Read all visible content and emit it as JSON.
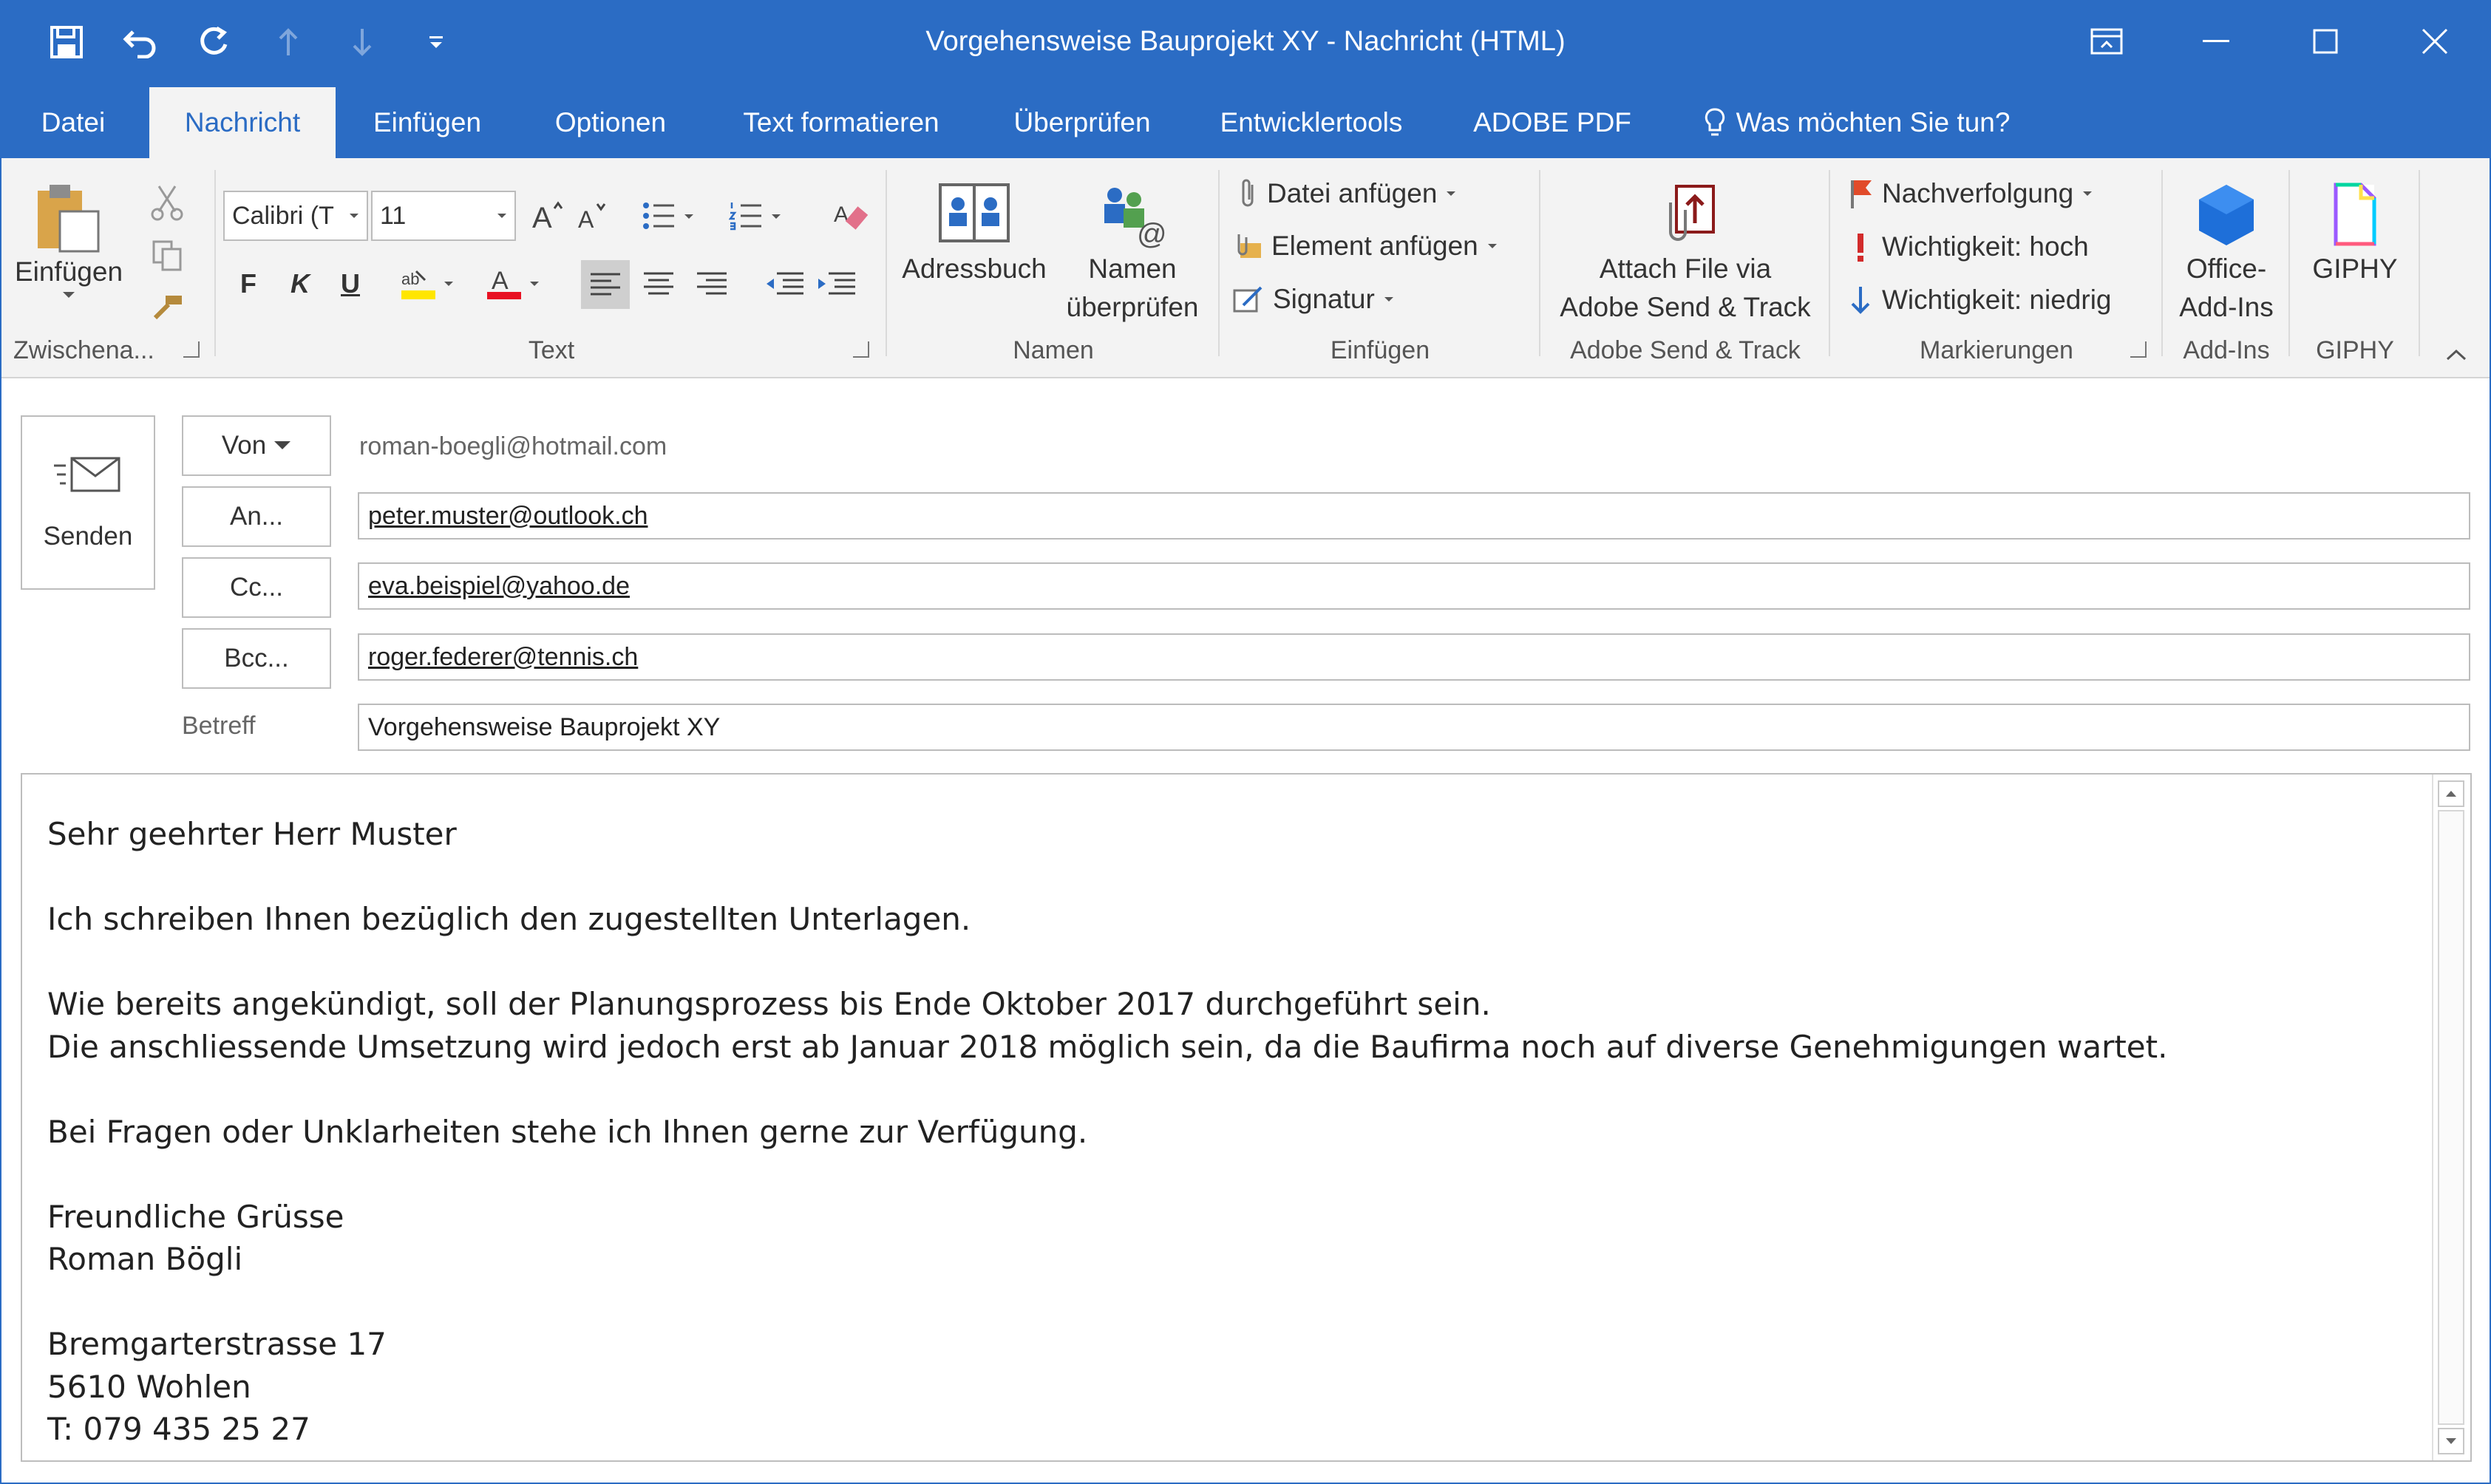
{
  "window": {
    "title": "Vorgehensweise Bauprojekt XY  -  Nachricht (HTML)"
  },
  "qat": {
    "icons": [
      "save-icon",
      "undo-icon",
      "redo-icon",
      "up-arrow-icon",
      "down-arrow-icon",
      "customize-icon"
    ]
  },
  "tabs": [
    {
      "label": "Datei"
    },
    {
      "label": "Nachricht"
    },
    {
      "label": "Einfügen"
    },
    {
      "label": "Optionen"
    },
    {
      "label": "Text formatieren"
    },
    {
      "label": "Überprüfen"
    },
    {
      "label": "Entwicklertools"
    },
    {
      "label": "ADOBE PDF"
    },
    {
      "label": "Was möchten Sie tun?"
    }
  ],
  "ribbon": {
    "clipboard": {
      "paste": "Einfügen",
      "group": "Zwischena..."
    },
    "text": {
      "font": "Calibri (T",
      "size": "11",
      "bold": "F",
      "italic": "K",
      "underline": "U",
      "group": "Text"
    },
    "names": {
      "addressbook": "Adressbuch",
      "check1": "Namen",
      "check2": "überprüfen",
      "group": "Namen"
    },
    "insert": {
      "file": "Datei anfügen",
      "item": "Element anfügen",
      "signature": "Signatur",
      "group": "Einfügen"
    },
    "adobe": {
      "line1": "Attach File via",
      "line2": "Adobe Send & Track",
      "group": "Adobe Send & Track"
    },
    "tags": {
      "followup": "Nachverfolgung",
      "high": "Wichtigkeit: hoch",
      "low": "Wichtigkeit: niedrig",
      "group": "Markierungen"
    },
    "addins": {
      "line1": "Office-",
      "line2": "Add-Ins",
      "group": "Add-Ins"
    },
    "giphy": {
      "label": "GIPHY",
      "group": "GIPHY"
    }
  },
  "compose": {
    "send": "Senden",
    "from_btn": "Von",
    "from": "roman-boegli@hotmail.com",
    "to_btn": "An...",
    "to": "peter.muster@outlook.ch",
    "cc_btn": "Cc...",
    "cc": "eva.beispiel@yahoo.de",
    "bcc_btn": "Bcc...",
    "bcc": "roger.federer@tennis.ch",
    "subject_label": "Betreff",
    "subject": "Vorgehensweise Bauprojekt XY"
  },
  "body": {
    "lines": [
      "Sehr geehrter Herr Muster",
      "",
      "Ich schreiben Ihnen bezüglich den zugestellten Unterlagen.",
      "",
      "Wie bereits angekündigt, soll der Planungsprozess bis Ende Oktober 2017 durchgeführt sein.",
      "Die anschliessende Umsetzung wird jedoch erst ab Januar 2018 möglich sein, da die Baufirma noch auf diverse Genehmigungen wartet.",
      "",
      "Bei Fragen oder Unklarheiten stehe ich Ihnen gerne zur Verfügung.",
      "",
      "Freundliche Grüsse",
      "Roman Bögli",
      "",
      "Bremgarterstrasse 17",
      "5610 Wohlen",
      "T: 079 435 25 27"
    ]
  },
  "colors": {
    "accent": "#2b6cc4",
    "ribbon_bg": "#f3f3f3"
  }
}
